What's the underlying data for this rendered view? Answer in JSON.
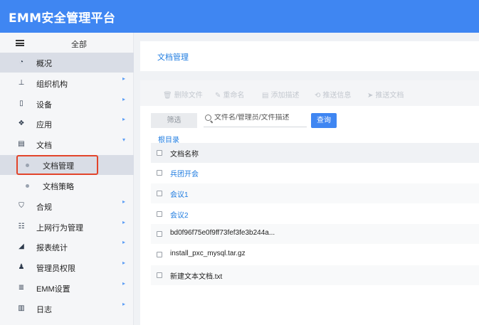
{
  "app": {
    "title": "EMM安全管理平台"
  },
  "sidebar": {
    "all_label": "全部",
    "items": [
      {
        "label": "概况",
        "icon": "pie-chart-icon",
        "glyph": "◔",
        "active": true,
        "arrow": ""
      },
      {
        "label": "组织机构",
        "icon": "org-chart-icon",
        "glyph": "⊥",
        "arrow": "▸"
      },
      {
        "label": "设备",
        "icon": "device-icon",
        "glyph": "▯",
        "arrow": "▸"
      },
      {
        "label": "应用",
        "icon": "app-icon",
        "glyph": "❖",
        "arrow": "▸"
      },
      {
        "label": "文档",
        "icon": "document-icon",
        "glyph": "▤",
        "arrow": "▾"
      },
      {
        "label": "合规",
        "icon": "shield-icon",
        "glyph": "⛉",
        "arrow": "▸"
      },
      {
        "label": "上网行为管理",
        "icon": "users-icon",
        "glyph": "☷",
        "arrow": "▸"
      },
      {
        "label": "报表统计",
        "icon": "area-chart-icon",
        "glyph": "◢",
        "arrow": "▸"
      },
      {
        "label": "管理员权限",
        "icon": "admin-icon",
        "glyph": "♟",
        "arrow": "▸"
      },
      {
        "label": "EMM设置",
        "icon": "server-icon",
        "glyph": "≣",
        "arrow": "▸"
      },
      {
        "label": "日志",
        "icon": "log-book-icon",
        "glyph": "▥",
        "arrow": "▸"
      }
    ],
    "sub_items": [
      {
        "label": "文档管理",
        "active": true
      },
      {
        "label": "文档策略"
      }
    ]
  },
  "main": {
    "breadcrumb": "文档管理",
    "toolbar": [
      {
        "label": "删除文件",
        "icon": "trash-icon",
        "glyph": "🗑"
      },
      {
        "label": "重命名",
        "icon": "edit-icon",
        "glyph": "✎"
      },
      {
        "label": "添加描述",
        "icon": "note-icon",
        "glyph": "▤"
      },
      {
        "label": "推送信息",
        "icon": "refresh-icon",
        "glyph": "⟲"
      },
      {
        "label": "推送文档",
        "icon": "send-icon",
        "glyph": "➤"
      }
    ],
    "filter_label": "筛选",
    "search_placeholder": "文件名/管理员/文件描述",
    "query_label": "查询",
    "root_label": "根目录",
    "table": {
      "header": "文档名称",
      "rows": [
        {
          "name": "兵团开会",
          "folder": true
        },
        {
          "name": "会议1",
          "folder": true
        },
        {
          "name": "会议2",
          "folder": true
        },
        {
          "name": "bd0f96f75e0f9ff73fef3fe3b244a...",
          "folder": false
        },
        {
          "name": "install_pxc_mysql.tar.gz",
          "folder": false
        },
        {
          "name": "新建文本文档.txt",
          "folder": false
        }
      ]
    }
  }
}
